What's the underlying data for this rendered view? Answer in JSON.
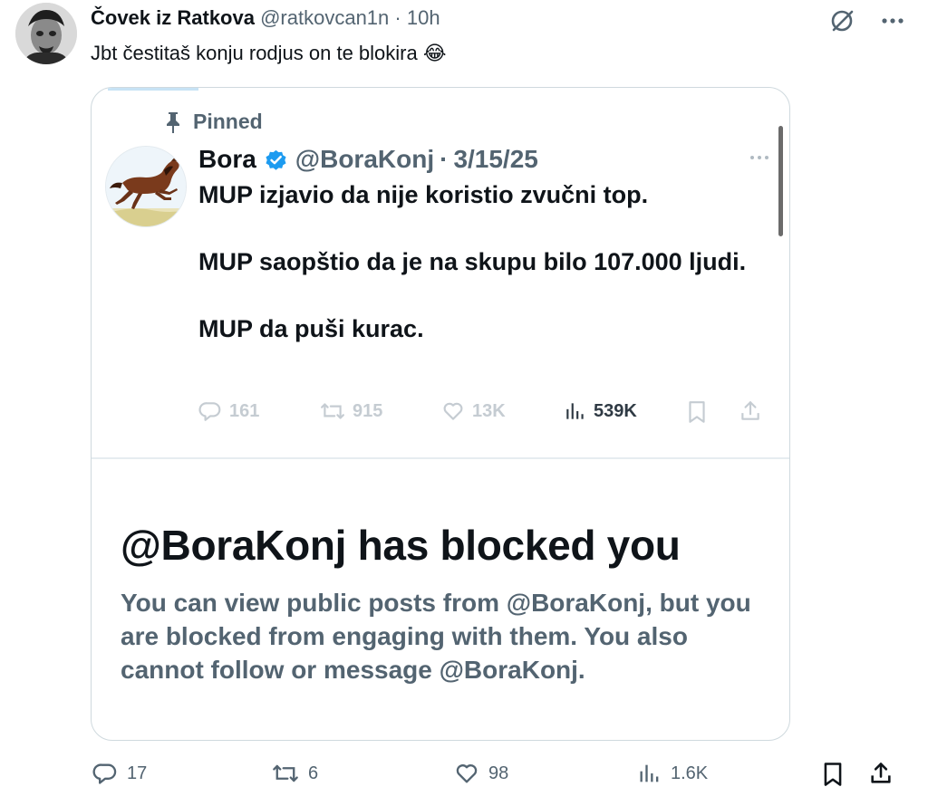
{
  "post": {
    "author_name": "Čovek iz Ratkova",
    "author_handle": "@ratkovcan1n",
    "separator": "·",
    "time": "10h",
    "text": "Jbt čestitaš konju rodjus on te blokira 😂",
    "stats": {
      "replies": "17",
      "reposts": "6",
      "likes": "98",
      "views": "1.6K"
    }
  },
  "quoted_post": {
    "pinned_label": "Pinned",
    "author_name": "Bora",
    "author_handle": "@BoraKonj",
    "separator": "·",
    "date": "3/15/25",
    "lines": [
      "MUP izjavio da nije koristio zvučni top.",
      "MUP saopštio da je na skupu bilo 107.000 ljudi.",
      "MUP da puši kurac."
    ],
    "stats": {
      "replies": "161",
      "reposts": "915",
      "likes": "13K",
      "views": "539K"
    }
  },
  "blocked": {
    "title": "@BoraKonj has blocked you",
    "description": "You can view public posts from @BoraKonj, but you are blocked from engaging with them. You also cannot follow or message @BoraKonj."
  },
  "icons": {
    "avatar": "avatar-image",
    "grok": "grok-icon",
    "more": "more-icon",
    "pin": "pin-icon",
    "verified": "verified-badge-icon",
    "reply": "reply-icon",
    "repost": "repost-icon",
    "like": "like-icon",
    "views": "views-icon",
    "bookmark": "bookmark-icon",
    "share": "share-icon"
  },
  "colors": {
    "text_primary": "#0f1419",
    "text_secondary": "#536471",
    "verified_blue": "#1d9bf0",
    "border": "#cfd9de",
    "disabled": "#c5ccd2"
  }
}
